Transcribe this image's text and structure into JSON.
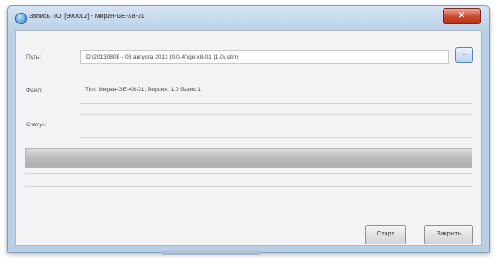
{
  "window": {
    "title": "Запись ПО: [900012] - Миран-GE-X8-01",
    "close_glyph": "✕"
  },
  "form": {
    "path_label": "Путь:",
    "path_value": "D:\\20130808 - 08 августа 2013 (0.0.4)\\ge-x8-01 (1.0).sbm",
    "browse_label": "...",
    "file_label": "Файл:",
    "file_value": "Тип: Миран-GE-X8-01, Версия: 1.0 базис 1",
    "status_label": "Статус:",
    "status_value": ""
  },
  "progress": {
    "value": 0
  },
  "buttons": {
    "start_label": "Старт",
    "close_label": "Закрыть"
  }
}
